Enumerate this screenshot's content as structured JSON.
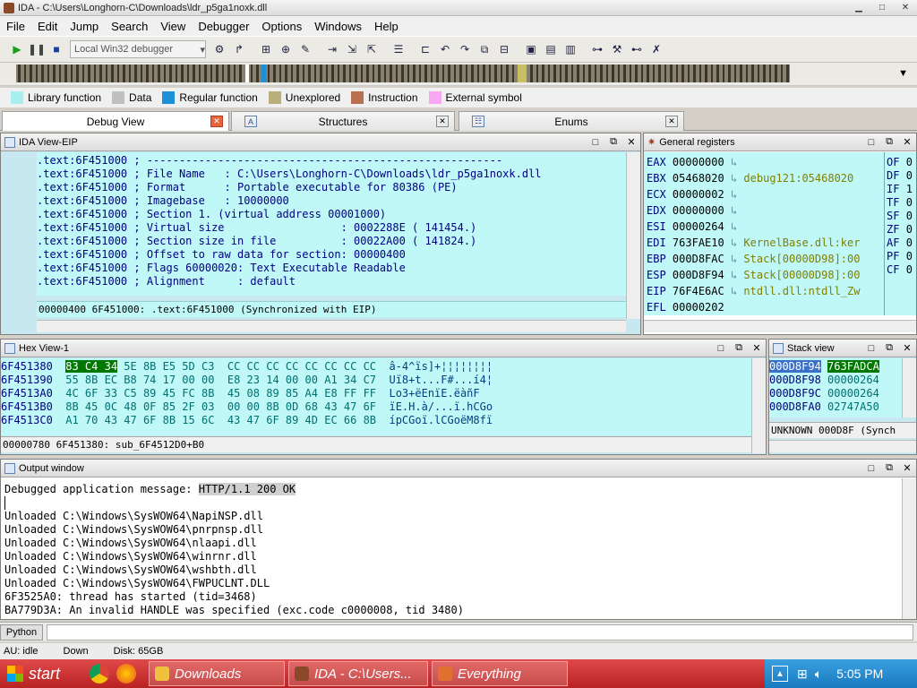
{
  "titlebar": {
    "title": "IDA - C:\\Users\\Longhorn-C\\Downloads\\ldr_p5ga1noxk.dll",
    "min": "▁",
    "max": "□",
    "close": "✕"
  },
  "menu": [
    "File",
    "Edit",
    "Jump",
    "Search",
    "View",
    "Debugger",
    "Options",
    "Windows",
    "Help"
  ],
  "toolbar": {
    "debugger_select": "Local Win32 debugger"
  },
  "legend": [
    {
      "label": "Library function",
      "color": "#a8f0f0"
    },
    {
      "label": "Data",
      "color": "#c0c0c0"
    },
    {
      "label": "Regular function",
      "color": "#1e90d8"
    },
    {
      "label": "Unexplored",
      "color": "#b8b078"
    },
    {
      "label": "Instruction",
      "color": "#b87050"
    },
    {
      "label": "External symbol",
      "color": "#f8a8f0"
    }
  ],
  "tabs": [
    {
      "label": "Debug View"
    },
    {
      "label": "Structures",
      "icon": "A"
    },
    {
      "label": "Enums",
      "icon": "☷"
    }
  ],
  "ida_view": {
    "title": "IDA View-EIP",
    "lines": [
      {
        "addr": ".text:6F451000",
        "text": " ; -------------------------------------------------------"
      },
      {
        "addr": ".text:6F451000",
        "text": " ; File Name   : C:\\Users\\Longhorn-C\\Downloads\\ldr_p5ga1noxk.dll"
      },
      {
        "addr": ".text:6F451000",
        "text": " ; Format      : Portable executable for 80386 (PE)"
      },
      {
        "addr": ".text:6F451000",
        "text": " ; Imagebase   : 10000000"
      },
      {
        "addr": ".text:6F451000",
        "text": " ; Section 1. (virtual address 00001000)"
      },
      {
        "addr": ".text:6F451000",
        "text": " ; Virtual size                  : 0002288E ( 141454.)"
      },
      {
        "addr": ".text:6F451000",
        "text": " ; Section size in file          : 00022A00 ( 141824.)"
      },
      {
        "addr": ".text:6F451000",
        "text": " ; Offset to raw data for section: 00000400"
      },
      {
        "addr": ".text:6F451000",
        "text": " ; Flags 60000020: Text Executable Readable"
      },
      {
        "addr": ".text:6F451000",
        "text": " ; Alignment     : default"
      }
    ],
    "status": "00000400 6F451000: .text:6F451000 (Synchronized with EIP)"
  },
  "registers": {
    "title": "General registers",
    "rows": [
      {
        "name": "EAX",
        "value": "00000000",
        "extra": ""
      },
      {
        "name": "EBX",
        "value": "05468020",
        "extra": "debug121:05468020"
      },
      {
        "name": "ECX",
        "value": "00000002",
        "extra": ""
      },
      {
        "name": "EDX",
        "value": "00000000",
        "extra": ""
      },
      {
        "name": "ESI",
        "value": "00000264",
        "extra": ""
      },
      {
        "name": "EDI",
        "value": "763FAE10",
        "extra": "KernelBase.dll:ker"
      },
      {
        "name": "EBP",
        "value": "000D8FAC",
        "extra": "Stack[00000D98]:00"
      },
      {
        "name": "ESP",
        "value": "000D8F94",
        "extra": "Stack[00000D98]:00"
      },
      {
        "name": "EIP",
        "value": "76F4E6AC",
        "extra": "ntdll.dll:ntdll_Zw"
      },
      {
        "name": "EFL",
        "value": "00000202",
        "extra": ""
      }
    ],
    "flags": [
      {
        "name": "OF",
        "value": "0"
      },
      {
        "name": "DF",
        "value": "0"
      },
      {
        "name": "IF",
        "value": "1"
      },
      {
        "name": "TF",
        "value": "0"
      },
      {
        "name": "SF",
        "value": "0"
      },
      {
        "name": "ZF",
        "value": "0"
      },
      {
        "name": "AF",
        "value": "0"
      },
      {
        "name": "PF",
        "value": "0"
      },
      {
        "name": "CF",
        "value": "0"
      }
    ]
  },
  "hex_view": {
    "title": "Hex View-1",
    "rows": [
      {
        "addr": "6F451380",
        "sel": "83 C4 34",
        "bytes": " 5E 8B E5 5D C3  CC CC CC CC CC CC CC CC",
        "ascii": "â-4^ïs]+¦¦¦¦¦¦¦¦"
      },
      {
        "addr": "6F451390",
        "sel": "",
        "bytes": "55 8B EC B8 74 17 00 00  E8 23 14 00 00 A1 34 C7",
        "ascii": "Uï8+t...F#...í4¦"
      },
      {
        "addr": "6F4513A0",
        "sel": "",
        "bytes": "4C 6F 33 C5 89 45 FC 8B  45 08 89 85 A4 E8 FF FF",
        "ascii": "Lo3+ëEnïE.ëàñF  "
      },
      {
        "addr": "6F4513B0",
        "sel": "",
        "bytes": "8B 45 0C 48 0F 85 2F 03  00 00 8B 0D 68 43 47 6F",
        "ascii": "ïE.H.à/...ï.hCGo"
      },
      {
        "addr": "6F4513C0",
        "sel": "",
        "bytes": "A1 70 43 47 6F 8B 15 6C  43 47 6F 89 4D EC 66 8B",
        "ascii": "ípCGoï.lCGoëM8fï"
      }
    ],
    "status": "00000780 6F451380: sub_6F4512D0+B0"
  },
  "stack_view": {
    "title": "Stack view",
    "rows": [
      {
        "addr": "000D8F94",
        "value": "763FADCA"
      },
      {
        "addr": "000D8F98",
        "value": "00000264"
      },
      {
        "addr": "000D8F9C",
        "value": "00000264"
      },
      {
        "addr": "000D8FA0",
        "value": "02747A50"
      }
    ],
    "status": "UNKNOWN 000D8F (Synch"
  },
  "output": {
    "title": "Output window",
    "msg_prefix": "Debugged application message: ",
    "msg_highlight": "HTTP/1.1 200 OK",
    "lines": [
      "",
      "Unloaded C:\\Windows\\SysWOW64\\NapiNSP.dll",
      "Unloaded C:\\Windows\\SysWOW64\\pnrpnsp.dll",
      "Unloaded C:\\Windows\\SysWOW64\\nlaapi.dll",
      "Unloaded C:\\Windows\\SysWOW64\\winrnr.dll",
      "Unloaded C:\\Windows\\SysWOW64\\wshbth.dll",
      "Unloaded C:\\Windows\\SysWOW64\\FWPUCLNT.DLL",
      "6F3525A0: thread has started (tid=3468)",
      "BA779D3A: An invalid HANDLE was specified (exc.code c0000008, tid 3480)"
    ]
  },
  "python": {
    "label": "Python"
  },
  "ida_status": {
    "au": "AU:  idle",
    "dir": "Down",
    "disk": "Disk: 65GB"
  },
  "taskbar": {
    "start": "start",
    "buttons": [
      {
        "label": "Downloads",
        "icon_color": "#f0c040"
      },
      {
        "label": "IDA - C:\\Users...",
        "icon_color": "#8a4a2a"
      },
      {
        "label": "Everything",
        "icon_color": "#e07030"
      }
    ],
    "clock": "5:05 PM"
  }
}
